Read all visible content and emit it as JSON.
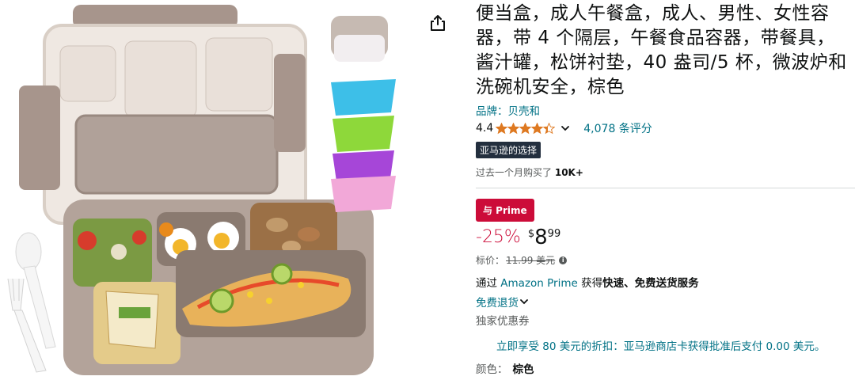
{
  "product": {
    "title": "便当盒，成人午餐盒，成人、男性、女性容器，带 4 个隔层，午餐食品容器，带餐具，酱汁罐，松饼衬垫，40 盎司/5 杯，微波炉和洗碗机安全，棕色",
    "brand_label": "品牌：贝壳和",
    "rating": "4.4",
    "rating_stars": 4.4,
    "review_count": "4,078 条评分",
    "choice_badge": "亚马逊的选择",
    "bought_prefix": "过去一个月购买了",
    "bought_count": "10K+",
    "deal_badge": "与 Prime",
    "discount": "-25%",
    "price_symbol": "$",
    "price_whole": "8",
    "price_fraction": "99",
    "list_price_label": "标价：",
    "list_price_value": "11.99 美元",
    "prime_prefix": "通过",
    "prime_link": "Amazon Prime",
    "prime_suffix": "获得",
    "prime_bold": "快速、免费送货服务",
    "returns": "免费退货",
    "offers": "独家优惠券",
    "card_offer": "立即享受 80 美元的折扣：亚马逊商店卡获得批准后支付 0.00 美元。",
    "color_label": "颜色：",
    "color_value": "棕色"
  },
  "colors": {
    "link": "#007185",
    "deal_red": "#cc0c39",
    "star": "#de7921",
    "choice_bg": "#232f3e",
    "box": "#a89890",
    "cup_blue": "#3dbfe8",
    "cup_green": "#8ed83a",
    "cup_purple": "#a646d8",
    "cup_pink": "#f2a8d8"
  },
  "icons": {
    "share": "share-icon",
    "chevron": "chevron-down-icon",
    "info": "info-icon"
  }
}
